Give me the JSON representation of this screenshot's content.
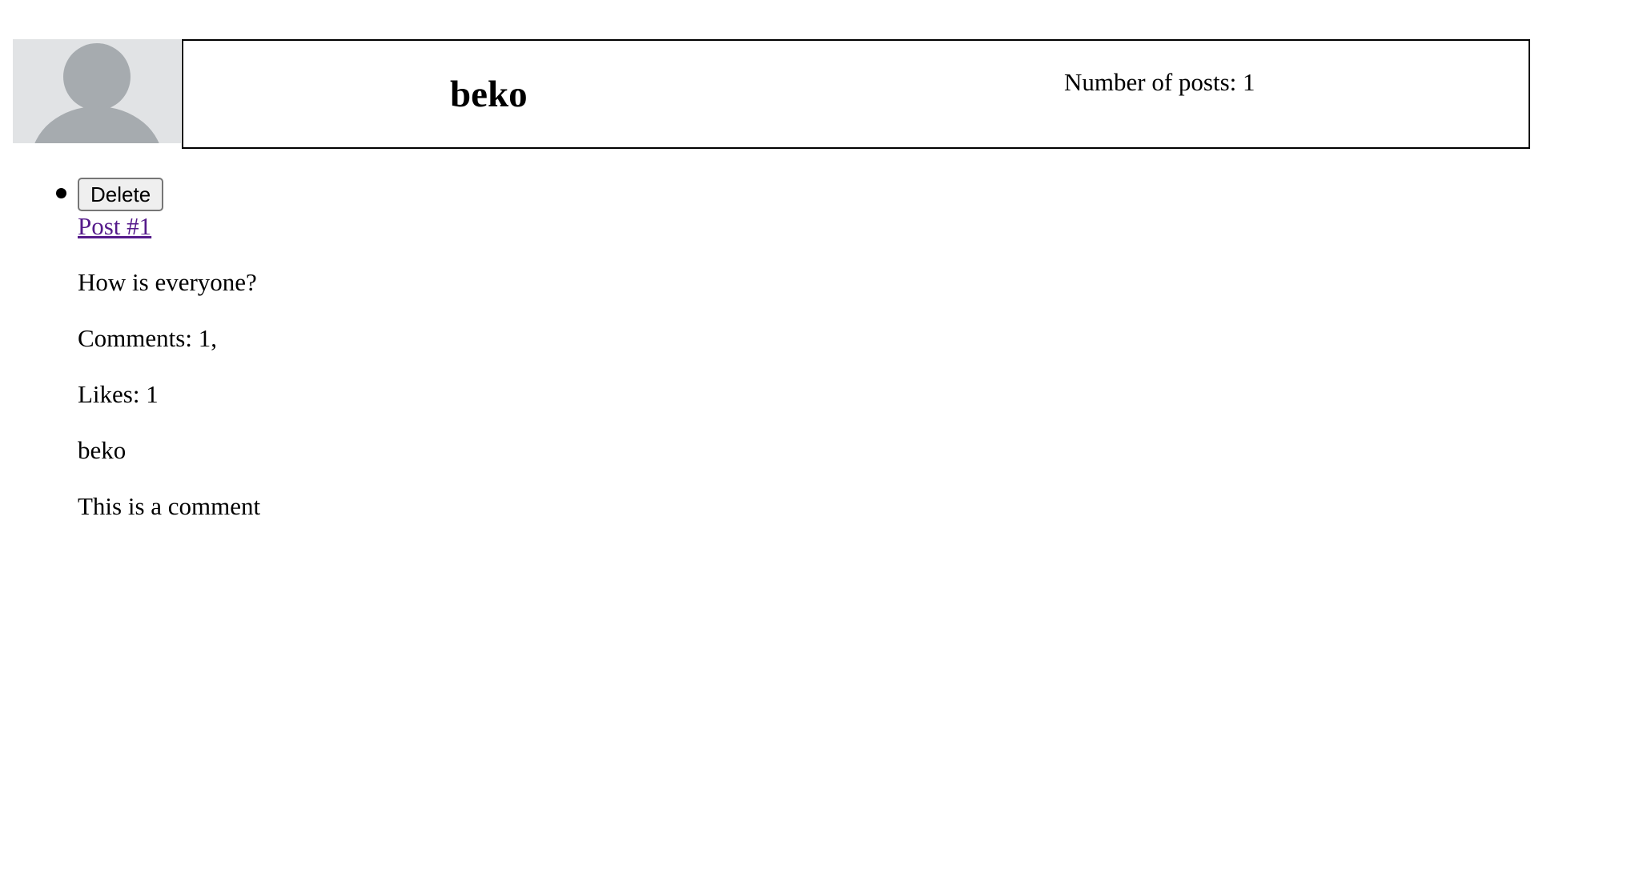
{
  "profile": {
    "avatar_icon": "default-user-avatar-icon",
    "username": "beko",
    "post_count_text": "Number of posts: 1"
  },
  "posts": [
    {
      "delete_label": "Delete",
      "title": "Post #1",
      "body": "How is everyone?",
      "comments_text": "Comments: 1,",
      "likes_text": "Likes: 1",
      "comment_author": "beko",
      "comment_text": "This is a comment"
    }
  ],
  "colors": {
    "avatar_bg": "#e1e3e5",
    "avatar_figure": "#a6abaf",
    "visited_link": "#551a8b"
  }
}
